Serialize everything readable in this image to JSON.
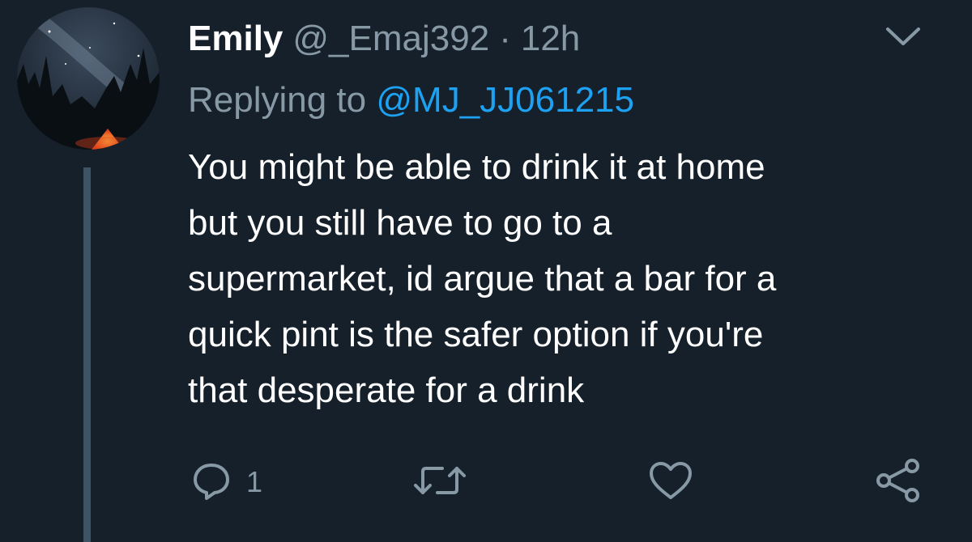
{
  "tweet": {
    "author_name": "Emily",
    "author_handle": "@_Emaj392",
    "separator": "·",
    "time": "12h",
    "replying_prefix": "Replying to",
    "replying_to": "@MJ_JJ061215",
    "body_lines": [
      "You might be able to drink it at home",
      "but you still have to go to a",
      "supermarket, id argue that a bar for a",
      "quick pint is the safer option if you're",
      "that desperate for a drink"
    ]
  },
  "actions": {
    "reply_count": "1",
    "retweet_count": "",
    "like_count": ""
  },
  "icons": {
    "menu": "chevron-down-icon",
    "reply": "reply-icon",
    "retweet": "retweet-icon",
    "like": "heart-icon",
    "share": "share-icon"
  },
  "colors": {
    "background": "#15202b",
    "text_primary": "#ffffff",
    "text_secondary": "#8899a6",
    "link": "#1da1f2",
    "thread_line": "#3d5466"
  }
}
